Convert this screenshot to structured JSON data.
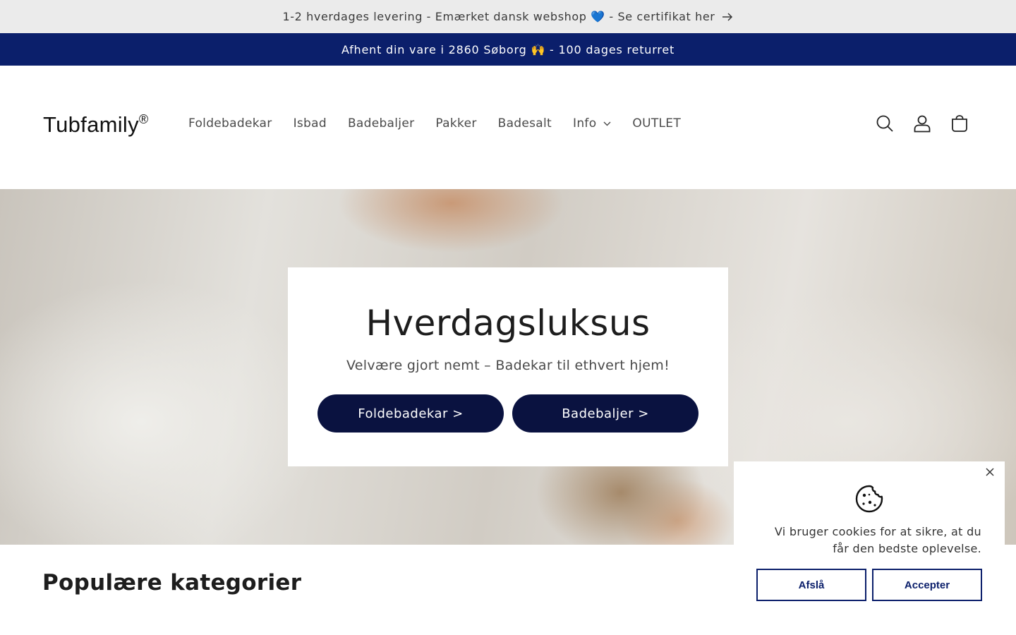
{
  "announcement": {
    "top_text": "1-2 hverdages levering - Emærket dansk webshop 💙 - Se certifikat her",
    "sub_text": "Afhent din vare i 2860 Søborg 🙌 - 100 dages returret"
  },
  "header": {
    "logo": "Tubfamily",
    "logo_mark": "®",
    "nav": [
      {
        "label": "Foldebadekar"
      },
      {
        "label": "Isbad"
      },
      {
        "label": "Badebaljer"
      },
      {
        "label": "Pakker"
      },
      {
        "label": "Badesalt"
      },
      {
        "label": "Info"
      },
      {
        "label": "OUTLET"
      }
    ],
    "icons": [
      "search-icon",
      "account-icon",
      "cart-icon"
    ]
  },
  "hero": {
    "title": "Hverdagsluksus",
    "subtitle": "Velvære gjort nemt – Badekar til ethvert hjem!",
    "buttons": [
      {
        "label": "Foldebadekar >"
      },
      {
        "label": "Badebaljer >"
      }
    ]
  },
  "sections": {
    "popular_title": "Populære kategorier"
  },
  "cookie_banner": {
    "text": "Vi bruger cookies for at sikre, at du får den bedste oplevelse.",
    "decline_label": "Afslå",
    "accept_label": "Accepter"
  },
  "colors": {
    "navy": "#0b1f6b",
    "button_dark": "#0a1240",
    "topbar_bg": "#ebebeb"
  }
}
